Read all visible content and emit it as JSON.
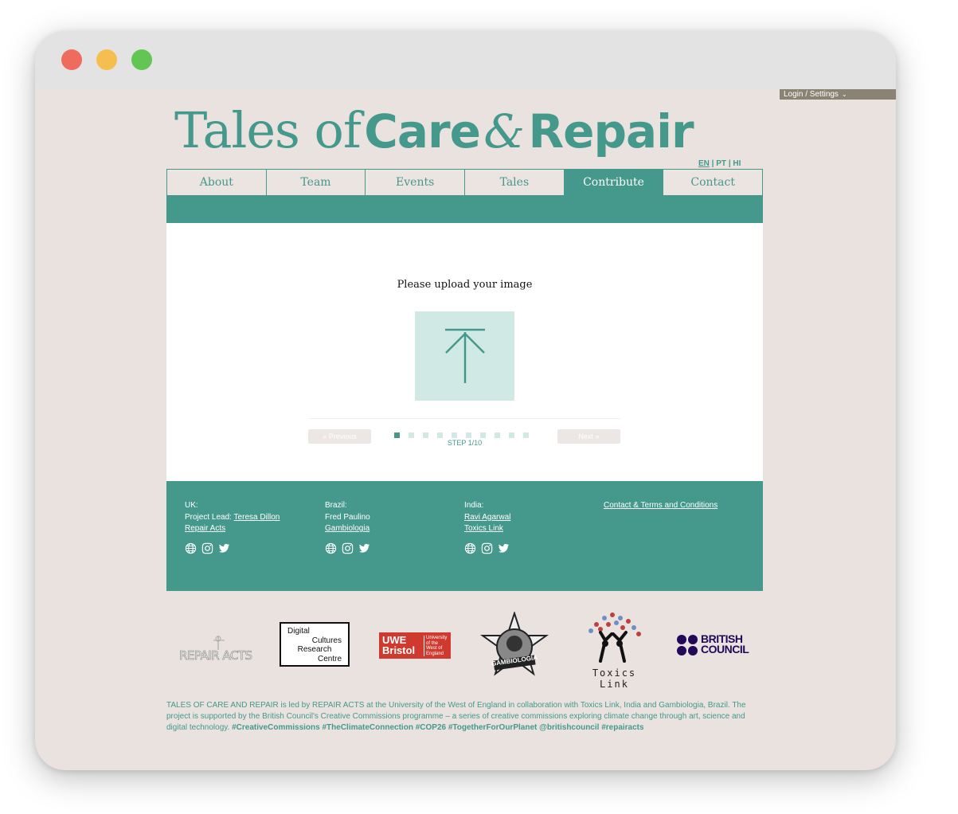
{
  "header": {
    "login_label": "Login / Settings",
    "title_part1": "Tales of",
    "title_part2": "Care",
    "title_amp": "&",
    "title_part3": "Repair",
    "langs": [
      "EN",
      "PT",
      "HI"
    ]
  },
  "nav": {
    "tabs": [
      "About",
      "Team",
      "Events",
      "Tales",
      "Contribute",
      "Contact"
    ],
    "active": "Contribute"
  },
  "upload": {
    "prompt": "Please upload your image",
    "prev_label": "« Previous",
    "next_label": "Next »",
    "step_label": "STEP 1/10",
    "current_step": 1,
    "total_steps": 10
  },
  "footer": {
    "uk": {
      "heading": "UK:",
      "lead_prefix": "Project Lead:",
      "lead_name": "Teresa Dillon",
      "org": "Repair Acts"
    },
    "brazil": {
      "heading": "Brazil:",
      "person": "Fred Paulino",
      "org": "Gambiologia"
    },
    "india": {
      "heading": "India:",
      "person": "Ravi Agarwal",
      "org": "Toxics Link"
    },
    "contact_link": "Contact & Terms and Conditions"
  },
  "logos": {
    "repair_acts": "REPAIR ACTS",
    "dcrc": [
      "Digital",
      "Cultures",
      "Research",
      "Centre"
    ],
    "uwe": {
      "main1": "UWE",
      "main2": "Bristol",
      "sub": [
        "University",
        "of the",
        "West of",
        "England"
      ]
    },
    "gambiologia": "GAMBIOLOGIA",
    "toxics": "Toxics Link",
    "british_council": [
      "BRITISH",
      "COUNCIL"
    ]
  },
  "about": {
    "text": "TALES OF CARE AND REPAIR is led by REPAIR ACTS at the University of the West of England in collaboration with Toxics Link, India and Gambiologia, Brazil. The project is supported by the British Council's Creative Commissions programme – a series of creative commissions exploring climate change through art, science and digital technology.",
    "tags": "#CreativeCommissions #TheClimateConnection #COP26 #TogetherForOurPlanet @britishcouncil #repairacts"
  },
  "colors": {
    "accent": "#45998c",
    "page_bg": "#e9e2df",
    "upload_bg": "#d1e9e5"
  }
}
